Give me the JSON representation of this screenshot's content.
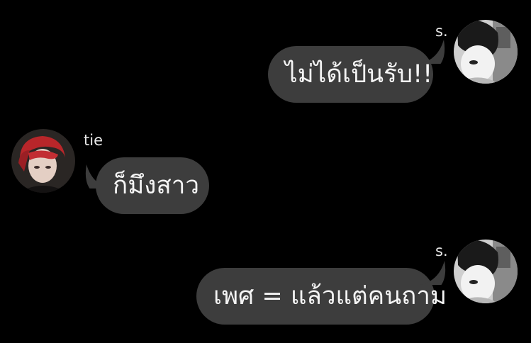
{
  "messages": [
    {
      "sender": "s.",
      "text": "ไม่ได้เป็นรับ!!",
      "side": "right"
    },
    {
      "sender": "tie",
      "text": "ก็มึงสาว",
      "side": "left"
    },
    {
      "sender": "s.",
      "text": "เพศ = แล้วแต่คนถาม",
      "side": "right"
    }
  ],
  "colors": {
    "background": "#000000",
    "bubble": "#3d3d3d",
    "text": "#f4f4f4",
    "sender_name": "#e8e8e8"
  },
  "avatars": {
    "s": "grayscale-portrait-avatar",
    "tie": "red-hair-portrait-avatar"
  }
}
